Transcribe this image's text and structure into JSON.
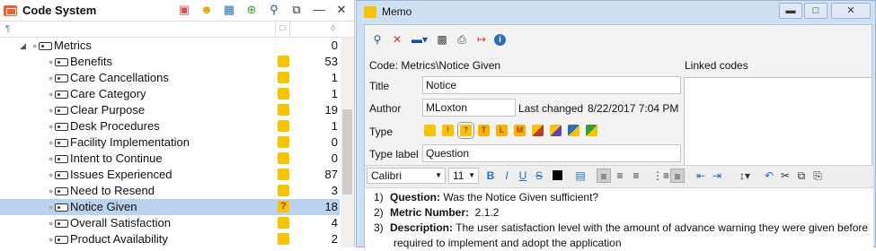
{
  "code_system": {
    "title": "Code System",
    "icons": [
      "activate-codes-icon",
      "smiley-icon",
      "code-matrix-icon",
      "new-code-icon",
      "search-icon",
      "undock-icon",
      "minimize-icon",
      "close-icon"
    ],
    "parent": {
      "label": "Metrics",
      "count": "0"
    },
    "rows": [
      {
        "label": "Benefits",
        "count": "53",
        "mark": "",
        "selected": false
      },
      {
        "label": "Care Cancellations",
        "count": "1",
        "mark": "",
        "selected": false
      },
      {
        "label": "Care Category",
        "count": "1",
        "mark": "",
        "selected": false
      },
      {
        "label": "Clear Purpose",
        "count": "19",
        "mark": "",
        "selected": false
      },
      {
        "label": "Desk Procedures",
        "count": "1",
        "mark": "",
        "selected": false
      },
      {
        "label": "Facility Implementation",
        "count": "0",
        "mark": "",
        "selected": false
      },
      {
        "label": "Intent to Continue",
        "count": "0",
        "mark": "",
        "selected": false
      },
      {
        "label": "Issues Experienced",
        "count": "87",
        "mark": "",
        "selected": false
      },
      {
        "label": "Need to Resend",
        "count": "3",
        "mark": "",
        "selected": false
      },
      {
        "label": "Notice Given",
        "count": "18",
        "mark": "?",
        "selected": true
      },
      {
        "label": "Overall Satisfaction",
        "count": "4",
        "mark": "",
        "selected": false
      },
      {
        "label": "Product Availability",
        "count": "2",
        "mark": "",
        "selected": false
      }
    ]
  },
  "memo": {
    "window_title": "Memo",
    "code_line": "Code: Metrics\\Notice Given",
    "linked_codes_label": "Linked codes",
    "title_label": "Title",
    "title_value": "Notice",
    "author_label": "Author",
    "author_value": "MLoxton",
    "last_changed_label": "Last changed",
    "last_changed_value": "8/22/2017 7:04 PM",
    "type_label": "Type",
    "type_swatches": [
      "",
      "!",
      "?",
      "T",
      "L",
      "M",
      "",
      "",
      "",
      ""
    ],
    "type_label_label": "Type label",
    "type_label_value": "Question",
    "font_name": "Calibri",
    "font_size": "11",
    "body": {
      "l1_num": "1)",
      "l1_bold": "Question:",
      "l1_text": " Was the Notice Given sufficient?",
      "l2_num": "2)",
      "l2_bold": "Metric Number:",
      "l2_text": "  2.1.2",
      "l3_num": "3)",
      "l3_bold": "Description:",
      "l3_text": " The user satisfaction level with the amount of advance warning they were given before",
      "l4_text": "required to implement and adopt the application"
    }
  },
  "colors": {
    "selection": "#b9d3ee",
    "code_yellow": "#f7c400",
    "brand_orange": "#e8622d"
  }
}
